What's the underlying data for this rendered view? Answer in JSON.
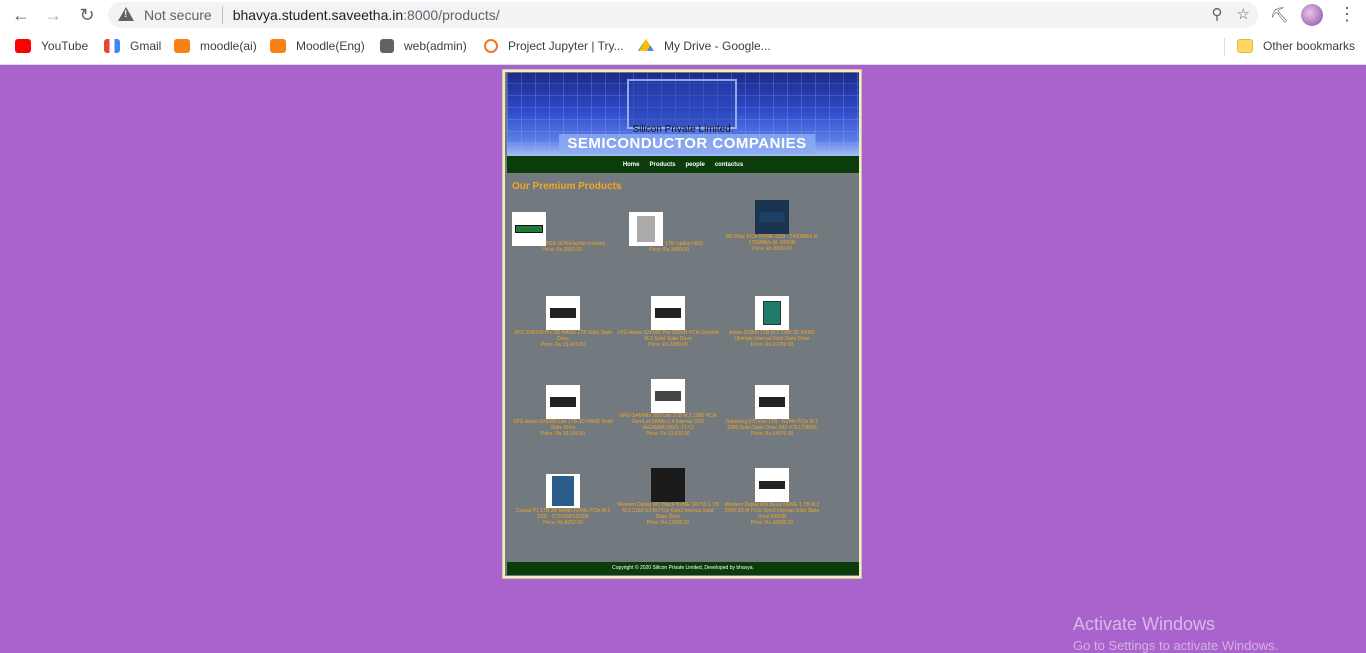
{
  "browser": {
    "security_label": "Not secure",
    "url_host": "bhavya.student.saveetha.in",
    "url_path": ":8000/products/"
  },
  "bookmarks": [
    {
      "label": "YouTube",
      "icon": "youtube-icon"
    },
    {
      "label": "Gmail",
      "icon": "gmail-icon"
    },
    {
      "label": "moodle(ai)",
      "icon": "moodle-icon"
    },
    {
      "label": "Moodle(Eng)",
      "icon": "moodle-icon"
    },
    {
      "label": "web(admin)",
      "icon": "globe-icon"
    },
    {
      "label": "Project Jupyter | Try...",
      "icon": "jupyter-icon"
    },
    {
      "label": "My Drive - Google...",
      "icon": "drive-icon"
    }
  ],
  "other_bookmarks": "Other bookmarks",
  "site": {
    "subtitle": "Silicon Private Limited.",
    "title": "SEMICONDUCTOR COMPANIES",
    "nav": [
      "Home",
      "Products",
      "people",
      "contactus"
    ],
    "heading": "Our Premium Products",
    "footer": "Copyright © 2020 Silicon Private Limited, Developed by bhavya."
  },
  "products": [
    {
      "name": "8GB DDR4 laptop memory",
      "price": "Price: Rs.2000.00"
    },
    {
      "name": "1TB Laptop HDD",
      "price": "Price: Rs.3000.00"
    },
    {
      "name": "WD Blue PCIe NVME SSD - 2400MB/s R, 1750MB/s W, 500GB",
      "price": "Price: Rs.6500.00"
    },
    {
      "name": "XPG SX8200 Pro 3D NAND 1TB Solid State Drive",
      "price": "Price: Rs.15,416.00"
    },
    {
      "name": "XPG Adata SX6000 Pro 256GB PCIe Gen3x4 M.2 Solid State Drive",
      "price": "Price: Rs.3999.00"
    },
    {
      "name": "Adata SU800 1TB M.2 2280 3D NAND Ultimate Internal Solid State Drive",
      "price": "Price: Rs.10799.00"
    },
    {
      "name": "XPG Adata SX8200 Lite 1TB 3D NAND Solid State Drive",
      "price": "Price: Rs.10,199.00"
    },
    {
      "name": "XPG GAMMIX S50 Lite 1TB M.2 2280 PCIe Gen4.x4 NVMe 1.4 Internal SSD (AGAMMIXS50L-1T-C)",
      "price": "Price: Rs.13,600.00"
    },
    {
      "name": "Samsung 970 Evo 1TB - NVMe PCIe M.2 2280 Solid State Drive (MZ-V7E1T0BW)",
      "price": "Price: Rs.14070.00"
    },
    {
      "name": "Crucial P1 1TB 3D NAND NVMe PCIe M.2 SSD - CT1000P1SSD8",
      "price": "Price: Rs.8252.00"
    },
    {
      "name": "Western Digital WD Black NVME SN750 1 TB M.2 2280-S3-M PCIe Gen3 Internal Solid State Drive",
      "price": "Price: Rs.12000.00"
    },
    {
      "name": "Western Digital WD Black NVME 1 TB M.2 2280-S3-M PCIe Gen3 Internal Solid State Drive,500GB",
      "price": "Price: Rs.10000.00"
    }
  ],
  "watermark": {
    "title": "Activate Windows",
    "subtitle": "Go to Settings to activate Windows."
  }
}
